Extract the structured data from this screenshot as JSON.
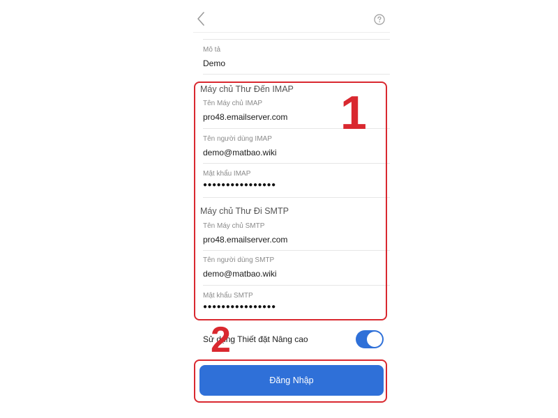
{
  "nav": {
    "back_icon": "chevron-left-icon",
    "help_icon": "question-circle-icon"
  },
  "description": {
    "label": "Mô tả",
    "value": "Demo"
  },
  "imap": {
    "section_title": "Máy chủ Thư Đến IMAP",
    "server_label": "Tên Máy chủ IMAP",
    "server_value": "pro48.emailserver.com",
    "username_label": "Tên người dùng IMAP",
    "username_value": "demo@matbao.wiki",
    "password_label": "Mật khẩu IMAP",
    "password_value": "●●●●●●●●●●●●●●●●"
  },
  "smtp": {
    "section_title": "Máy chủ Thư Đi SMTP",
    "server_label": "Tên Máy chủ SMTP",
    "server_value": "pro48.emailserver.com",
    "username_label": "Tên người dùng SMTP",
    "username_value": "demo@matbao.wiki",
    "password_label": "Mật khẩu SMTP",
    "password_value": "●●●●●●●●●●●●●●●●"
  },
  "advanced": {
    "label": "Sử dụng Thiết đặt Nâng cao",
    "enabled": true
  },
  "login_button": {
    "label": "Đăng Nhập"
  },
  "annotations": {
    "step1": "1",
    "step2": "2"
  },
  "colors": {
    "accent": "#2f70d8",
    "annotation": "#d9282f"
  }
}
